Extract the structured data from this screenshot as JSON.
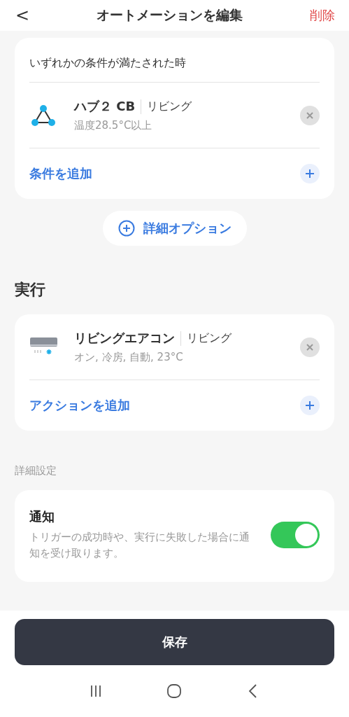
{
  "header": {
    "back": "<",
    "title": "オートメーションを編集",
    "delete": "削除"
  },
  "condition_card": {
    "heading": "いずれかの条件が満たされた時",
    "items": [
      {
        "kind": "hub",
        "name": "ハブ２ CB",
        "room": "リビング",
        "detail": "温度28.5°C以上"
      }
    ],
    "add_label": "条件を追加"
  },
  "options_button": "詳細オプション",
  "action_section": {
    "heading": "実行",
    "items": [
      {
        "kind": "aircon",
        "name": "リビングエアコン",
        "room": "リビング",
        "detail": "オン, 冷房, 自動, 23°C"
      }
    ],
    "add_label": "アクションを追加"
  },
  "settings_section": {
    "heading": "詳細設定",
    "notification": {
      "title": "通知",
      "description": "トリガーの成功時や、実行に失敗した場合に通知を受け取ります。",
      "on": true
    }
  },
  "save_button": "保存"
}
